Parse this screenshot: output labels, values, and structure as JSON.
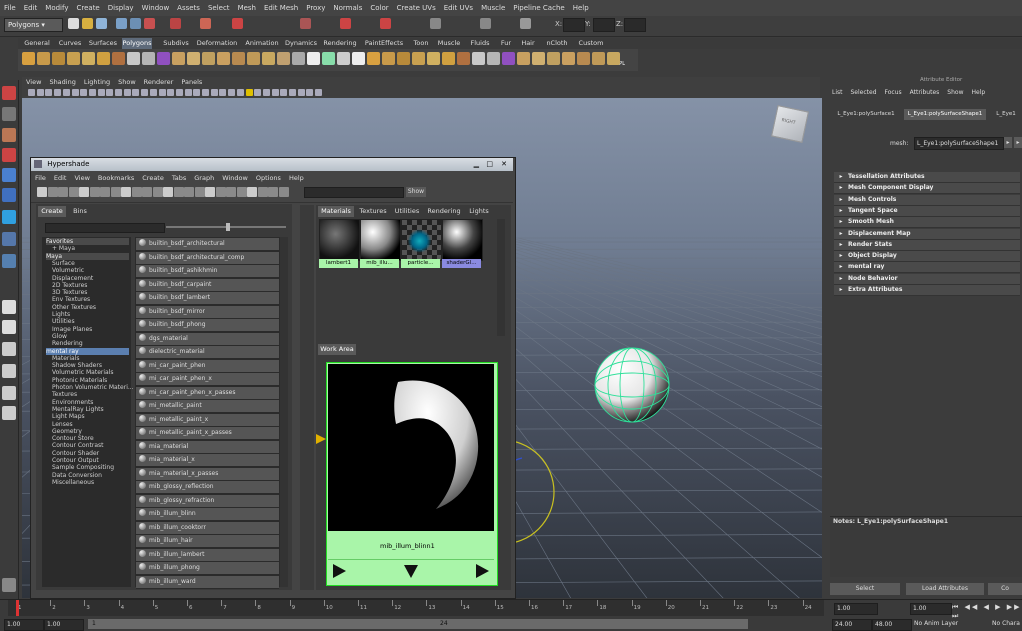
{
  "main_menu": [
    "File",
    "Edit",
    "Modify",
    "Create",
    "Display",
    "Window",
    "Assets",
    "Select",
    "Mesh",
    "Edit Mesh",
    "Proxy",
    "Normals",
    "Color",
    "Create UVs",
    "Edit UVs",
    "Muscle",
    "Pipeline Cache",
    "Help"
  ],
  "mode_selector": "Polygons",
  "xyz_labels": [
    "X:",
    "Y:",
    "Z:"
  ],
  "shelf_tabs": [
    "General",
    "Curves",
    "Surfaces",
    "Polygons",
    "Subdivs",
    "Deformation",
    "Animation",
    "Dynamics",
    "Rendering",
    "PaintEffects",
    "Toon",
    "Muscle",
    "Fluids",
    "Fur",
    "Hair",
    "nCloth",
    "Custom"
  ],
  "shelf_active": "Polygons",
  "shelf_last_label": "SPL",
  "panel_menu": [
    "View",
    "Shading",
    "Lighting",
    "Show",
    "Renderer",
    "Panels"
  ],
  "viewcube_label": "RIGHT",
  "hypershade": {
    "title": "Hypershade",
    "menu": [
      "File",
      "Edit",
      "View",
      "Bookmarks",
      "Create",
      "Tabs",
      "Graph",
      "Window",
      "Options",
      "Help"
    ],
    "show_button": "Show",
    "left_tabs": [
      "Create",
      "Bins"
    ],
    "tree": [
      {
        "label": "Favorites",
        "kind": "hdr"
      },
      {
        "label": "+ Maya",
        "kind": "item"
      },
      {
        "label": "Maya",
        "kind": "hdr"
      },
      {
        "label": "Surface",
        "kind": "item"
      },
      {
        "label": "Volumetric",
        "kind": "item"
      },
      {
        "label": "Displacement",
        "kind": "item"
      },
      {
        "label": "2D Textures",
        "kind": "item"
      },
      {
        "label": "3D Textures",
        "kind": "item"
      },
      {
        "label": "Env Textures",
        "kind": "item"
      },
      {
        "label": "Other Textures",
        "kind": "item"
      },
      {
        "label": "Lights",
        "kind": "item"
      },
      {
        "label": "Utilities",
        "kind": "item"
      },
      {
        "label": "Image Planes",
        "kind": "item"
      },
      {
        "label": "Glow",
        "kind": "item"
      },
      {
        "label": "Rendering",
        "kind": "item"
      },
      {
        "label": "mental ray",
        "kind": "sel"
      },
      {
        "label": "Materials",
        "kind": "item"
      },
      {
        "label": "Shadow Shaders",
        "kind": "item"
      },
      {
        "label": "Volumetric Materials",
        "kind": "item"
      },
      {
        "label": "Photonic Materials",
        "kind": "item"
      },
      {
        "label": "Photon Volumetric Materi...",
        "kind": "item"
      },
      {
        "label": "Textures",
        "kind": "item"
      },
      {
        "label": "Environments",
        "kind": "item"
      },
      {
        "label": "MentalRay Lights",
        "kind": "item"
      },
      {
        "label": "Light Maps",
        "kind": "item"
      },
      {
        "label": "Lenses",
        "kind": "item"
      },
      {
        "label": "Geometry",
        "kind": "item"
      },
      {
        "label": "Contour Store",
        "kind": "item"
      },
      {
        "label": "Contour Contrast",
        "kind": "item"
      },
      {
        "label": "Contour Shader",
        "kind": "item"
      },
      {
        "label": "Contour Output",
        "kind": "item"
      },
      {
        "label": "Sample Compositing",
        "kind": "item"
      },
      {
        "label": "Data Conversion",
        "kind": "item"
      },
      {
        "label": "Miscellaneous",
        "kind": "item"
      }
    ],
    "nodes": [
      "builtin_bsdf_architectural",
      "builtin_bsdf_architectural_comp",
      "builtin_bsdf_ashikhmin",
      "builtin_bsdf_carpaint",
      "builtin_bsdf_lambert",
      "builtin_bsdf_mirror",
      "builtin_bsdf_phong",
      "dgs_material",
      "dielectric_material",
      "mi_car_paint_phen",
      "mi_car_paint_phen_x",
      "mi_car_paint_phen_x_passes",
      "mi_metallic_paint",
      "mi_metallic_paint_x",
      "mi_metallic_paint_x_passes",
      "mia_material",
      "mia_material_x",
      "mia_material_x_passes",
      "mib_glossy_reflection",
      "mib_glossy_refraction",
      "mib_illum_blinn",
      "mib_illum_cooktorr",
      "mib_illum_hair",
      "mib_illum_lambert",
      "mib_illum_phong",
      "mib_illum_ward"
    ],
    "right_tabs": [
      "Materials",
      "Textures",
      "Utilities",
      "Rendering",
      "Lights"
    ],
    "swatches": [
      "lambert1",
      "mib_illu...",
      "particle...",
      "shaderGl..."
    ],
    "work_area_tab": "Work Area",
    "node_name": "mib_illum_blinn1"
  },
  "attribute_editor": {
    "title": "Attribute Editor",
    "menu": [
      "List",
      "Selected",
      "Focus",
      "Attributes",
      "Show",
      "Help"
    ],
    "tabs": [
      "L_Eye1:polySurface1",
      "L_Eye1:polySurfaceShape1",
      "L_Eye1"
    ],
    "mesh_label": "mesh:",
    "mesh_value": "L_Eye1:polySurfaceShape1",
    "sections": [
      "Tessellation Attributes",
      "Mesh Component Display",
      "Mesh Controls",
      "Tangent Space",
      "Smooth Mesh",
      "Displacement Map",
      "Render Stats",
      "Object Display",
      "mental ray",
      "Node Behavior",
      "Extra Attributes"
    ],
    "notes": "Notes:  L_Eye1:polySurfaceShape1",
    "buttons": [
      "Select",
      "Load Attributes",
      "Co"
    ]
  },
  "timeline": {
    "ticks": [
      "1",
      "2",
      "3",
      "4",
      "5",
      "6",
      "7",
      "8",
      "9",
      "10",
      "11",
      "12",
      "13",
      "14",
      "15",
      "16",
      "17",
      "18",
      "19",
      "20",
      "21",
      "22",
      "23",
      "24"
    ],
    "current_frame": "1.00",
    "range_start": "1.00",
    "range_start2": "1.00",
    "range_slider_start": "1",
    "range_slider_end": "24",
    "end_time": "24.00",
    "end_time2": "48.00",
    "anim_layer": "No Anim Layer",
    "char_set": "No Chara"
  }
}
